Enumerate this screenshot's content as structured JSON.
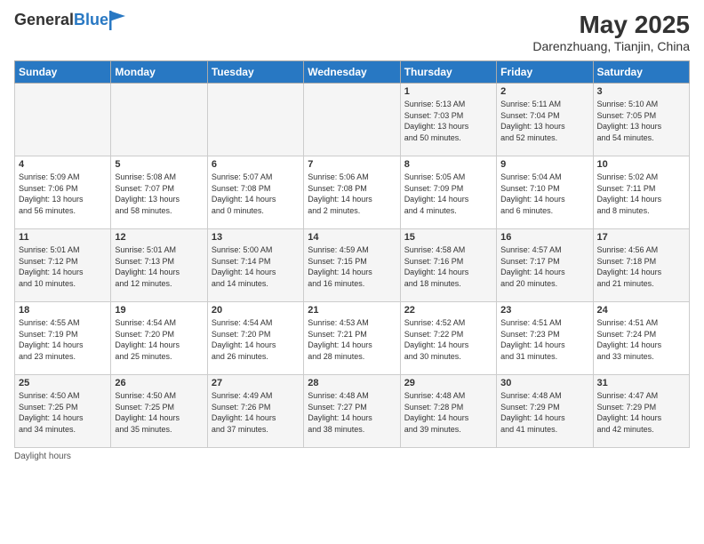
{
  "header": {
    "logo_general": "General",
    "logo_blue": "Blue",
    "month_year": "May 2025",
    "location": "Darenzhuang, Tianjin, China"
  },
  "weekdays": [
    "Sunday",
    "Monday",
    "Tuesday",
    "Wednesday",
    "Thursday",
    "Friday",
    "Saturday"
  ],
  "footer": "Daylight hours",
  "weeks": [
    [
      {
        "day": "",
        "info": ""
      },
      {
        "day": "",
        "info": ""
      },
      {
        "day": "",
        "info": ""
      },
      {
        "day": "",
        "info": ""
      },
      {
        "day": "1",
        "info": "Sunrise: 5:13 AM\nSunset: 7:03 PM\nDaylight: 13 hours\nand 50 minutes."
      },
      {
        "day": "2",
        "info": "Sunrise: 5:11 AM\nSunset: 7:04 PM\nDaylight: 13 hours\nand 52 minutes."
      },
      {
        "day": "3",
        "info": "Sunrise: 5:10 AM\nSunset: 7:05 PM\nDaylight: 13 hours\nand 54 minutes."
      }
    ],
    [
      {
        "day": "4",
        "info": "Sunrise: 5:09 AM\nSunset: 7:06 PM\nDaylight: 13 hours\nand 56 minutes."
      },
      {
        "day": "5",
        "info": "Sunrise: 5:08 AM\nSunset: 7:07 PM\nDaylight: 13 hours\nand 58 minutes."
      },
      {
        "day": "6",
        "info": "Sunrise: 5:07 AM\nSunset: 7:08 PM\nDaylight: 14 hours\nand 0 minutes."
      },
      {
        "day": "7",
        "info": "Sunrise: 5:06 AM\nSunset: 7:08 PM\nDaylight: 14 hours\nand 2 minutes."
      },
      {
        "day": "8",
        "info": "Sunrise: 5:05 AM\nSunset: 7:09 PM\nDaylight: 14 hours\nand 4 minutes."
      },
      {
        "day": "9",
        "info": "Sunrise: 5:04 AM\nSunset: 7:10 PM\nDaylight: 14 hours\nand 6 minutes."
      },
      {
        "day": "10",
        "info": "Sunrise: 5:02 AM\nSunset: 7:11 PM\nDaylight: 14 hours\nand 8 minutes."
      }
    ],
    [
      {
        "day": "11",
        "info": "Sunrise: 5:01 AM\nSunset: 7:12 PM\nDaylight: 14 hours\nand 10 minutes."
      },
      {
        "day": "12",
        "info": "Sunrise: 5:01 AM\nSunset: 7:13 PM\nDaylight: 14 hours\nand 12 minutes."
      },
      {
        "day": "13",
        "info": "Sunrise: 5:00 AM\nSunset: 7:14 PM\nDaylight: 14 hours\nand 14 minutes."
      },
      {
        "day": "14",
        "info": "Sunrise: 4:59 AM\nSunset: 7:15 PM\nDaylight: 14 hours\nand 16 minutes."
      },
      {
        "day": "15",
        "info": "Sunrise: 4:58 AM\nSunset: 7:16 PM\nDaylight: 14 hours\nand 18 minutes."
      },
      {
        "day": "16",
        "info": "Sunrise: 4:57 AM\nSunset: 7:17 PM\nDaylight: 14 hours\nand 20 minutes."
      },
      {
        "day": "17",
        "info": "Sunrise: 4:56 AM\nSunset: 7:18 PM\nDaylight: 14 hours\nand 21 minutes."
      }
    ],
    [
      {
        "day": "18",
        "info": "Sunrise: 4:55 AM\nSunset: 7:19 PM\nDaylight: 14 hours\nand 23 minutes."
      },
      {
        "day": "19",
        "info": "Sunrise: 4:54 AM\nSunset: 7:20 PM\nDaylight: 14 hours\nand 25 minutes."
      },
      {
        "day": "20",
        "info": "Sunrise: 4:54 AM\nSunset: 7:20 PM\nDaylight: 14 hours\nand 26 minutes."
      },
      {
        "day": "21",
        "info": "Sunrise: 4:53 AM\nSunset: 7:21 PM\nDaylight: 14 hours\nand 28 minutes."
      },
      {
        "day": "22",
        "info": "Sunrise: 4:52 AM\nSunset: 7:22 PM\nDaylight: 14 hours\nand 30 minutes."
      },
      {
        "day": "23",
        "info": "Sunrise: 4:51 AM\nSunset: 7:23 PM\nDaylight: 14 hours\nand 31 minutes."
      },
      {
        "day": "24",
        "info": "Sunrise: 4:51 AM\nSunset: 7:24 PM\nDaylight: 14 hours\nand 33 minutes."
      }
    ],
    [
      {
        "day": "25",
        "info": "Sunrise: 4:50 AM\nSunset: 7:25 PM\nDaylight: 14 hours\nand 34 minutes."
      },
      {
        "day": "26",
        "info": "Sunrise: 4:50 AM\nSunset: 7:25 PM\nDaylight: 14 hours\nand 35 minutes."
      },
      {
        "day": "27",
        "info": "Sunrise: 4:49 AM\nSunset: 7:26 PM\nDaylight: 14 hours\nand 37 minutes."
      },
      {
        "day": "28",
        "info": "Sunrise: 4:48 AM\nSunset: 7:27 PM\nDaylight: 14 hours\nand 38 minutes."
      },
      {
        "day": "29",
        "info": "Sunrise: 4:48 AM\nSunset: 7:28 PM\nDaylight: 14 hours\nand 39 minutes."
      },
      {
        "day": "30",
        "info": "Sunrise: 4:48 AM\nSunset: 7:29 PM\nDaylight: 14 hours\nand 41 minutes."
      },
      {
        "day": "31",
        "info": "Sunrise: 4:47 AM\nSunset: 7:29 PM\nDaylight: 14 hours\nand 42 minutes."
      }
    ]
  ]
}
